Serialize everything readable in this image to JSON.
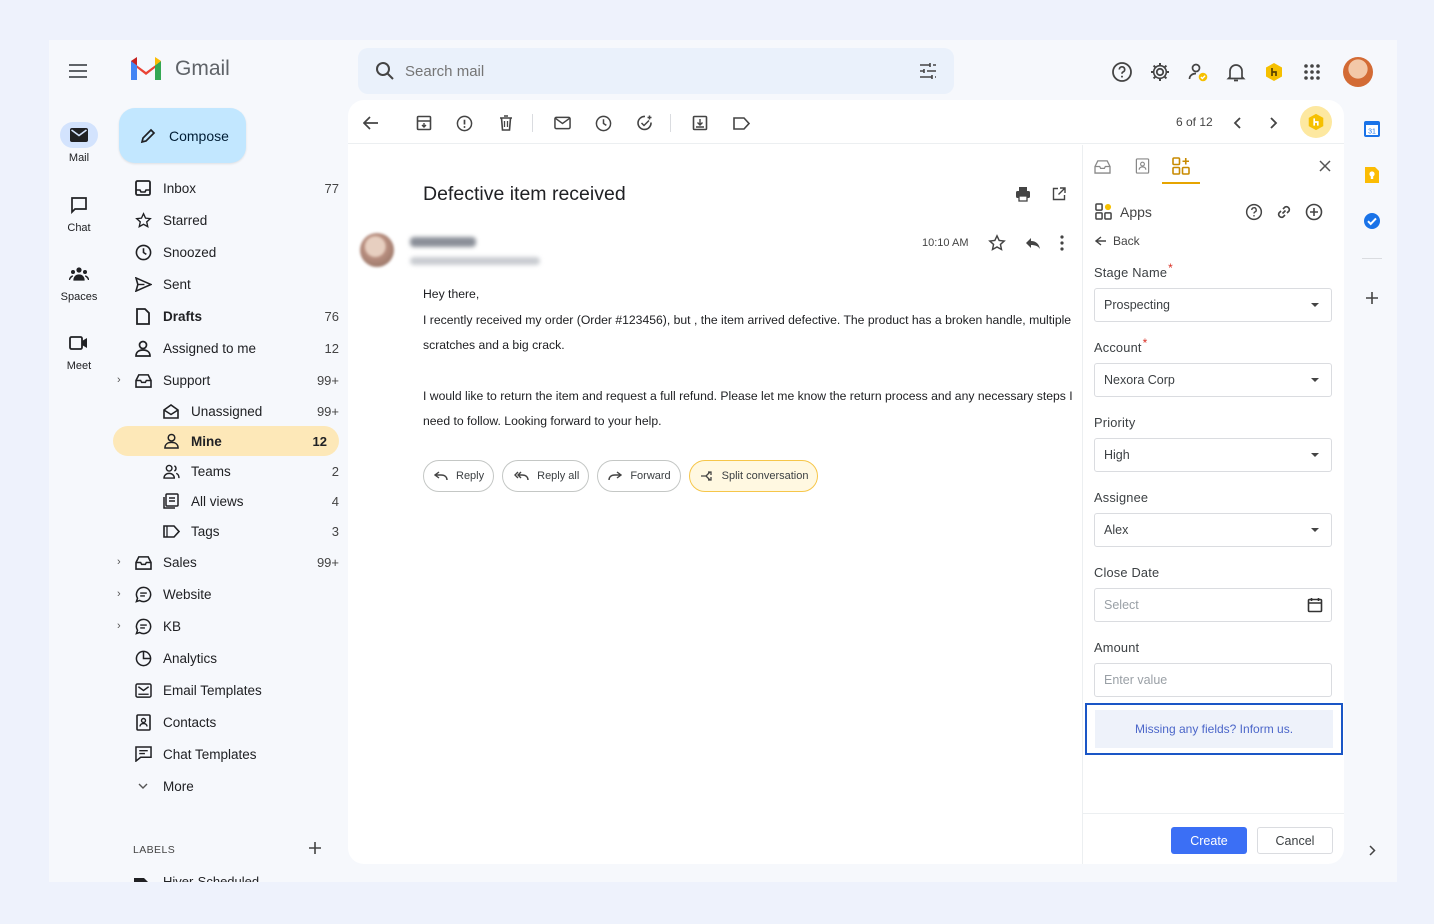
{
  "app": {
    "name": "Gmail"
  },
  "search": {
    "placeholder": "Search mail"
  },
  "rail": [
    {
      "label": "Mail",
      "icon": "mail-icon"
    },
    {
      "label": "Chat",
      "icon": "chat-icon"
    },
    {
      "label": "Spaces",
      "icon": "spaces-icon"
    },
    {
      "label": "Meet",
      "icon": "meet-icon"
    }
  ],
  "compose": {
    "label": "Compose"
  },
  "nav": {
    "inbox": {
      "label": "Inbox",
      "count": "77"
    },
    "starred": {
      "label": "Starred"
    },
    "snoozed": {
      "label": "Snoozed"
    },
    "sent": {
      "label": "Sent"
    },
    "drafts": {
      "label": "Drafts",
      "count": "76"
    },
    "assigned": {
      "label": "Assigned to me",
      "count": "12"
    },
    "support": {
      "label": "Support",
      "count": "99+"
    },
    "unassigned": {
      "label": "Unassigned",
      "count": "99+"
    },
    "mine": {
      "label": "Mine",
      "count": "12"
    },
    "teams": {
      "label": "Teams",
      "count": "2"
    },
    "allviews": {
      "label": "All views",
      "count": "4"
    },
    "tags": {
      "label": "Tags",
      "count": "3"
    },
    "sales": {
      "label": "Sales",
      "count": "99+"
    },
    "website": {
      "label": "Website"
    },
    "kb": {
      "label": "KB"
    },
    "analytics": {
      "label": "Analytics"
    },
    "emailtemplates": {
      "label": "Email Templates"
    },
    "contacts": {
      "label": "Contacts"
    },
    "chattemplates": {
      "label": "Chat Templates"
    },
    "more": {
      "label": "More"
    }
  },
  "labels": {
    "header": "LABELS",
    "first": "Hiver-Scheduled"
  },
  "toolbar": {
    "pager": "6 of 12"
  },
  "email": {
    "subject": "Defective item received",
    "time": "10:10 AM",
    "greeting": "Hey there,",
    "para1": "I recently received my order (Order #123456), but , the item arrived defective. The product has a broken handle, multiple scratches and a big crack.",
    "para2": "I would like to return the item and request a full refund. Please let me know the return process and any necessary steps I need to follow.  Looking forward to your help."
  },
  "actions": {
    "reply": "Reply",
    "reply_all": "Reply all",
    "forward": "Forward",
    "split": "Split conversation"
  },
  "panel": {
    "apps": "Apps",
    "back": "Back",
    "stage_label": "Stage Name",
    "stage_value": "Prospecting",
    "account_label": "Account",
    "account_value": "Nexora Corp",
    "priority_label": "Priority",
    "priority_value": "High",
    "assignee_label": "Assignee",
    "assignee_value": "Alex",
    "close_label": "Close Date",
    "close_placeholder": "Select",
    "amount_label": "Amount",
    "amount_placeholder": "Enter value",
    "missing": "Missing any fields? Inform us.",
    "create": "Create",
    "cancel": "Cancel",
    "required_mark": "*"
  },
  "colors": {
    "accent": "#3b6ff5",
    "active_nav": "#fde8b8",
    "compose": "#c2e7ff",
    "highlight_border": "#1a56c6"
  }
}
